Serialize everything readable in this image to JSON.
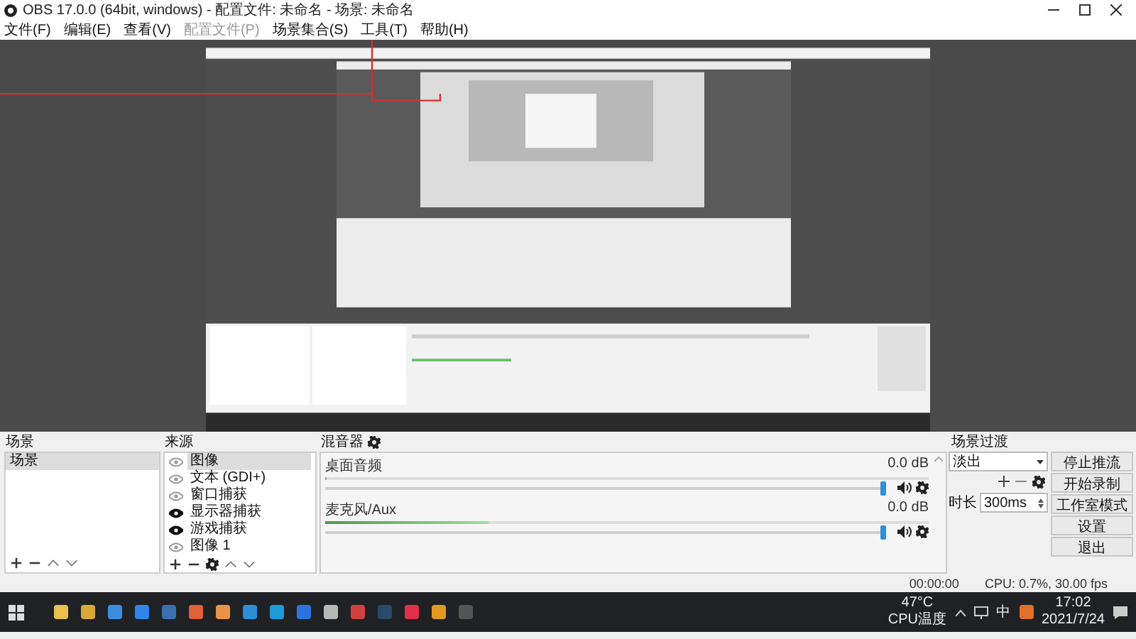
{
  "window": {
    "title": "OBS 17.0.0 (64bit, windows) - 配置文件: 未命名 - 场景: 未命名"
  },
  "menu": [
    {
      "label": "文件(F)",
      "disabled": false
    },
    {
      "label": "编辑(E)",
      "disabled": false
    },
    {
      "label": "查看(V)",
      "disabled": false
    },
    {
      "label": "配置文件(P)",
      "disabled": true
    },
    {
      "label": "场景集合(S)",
      "disabled": false
    },
    {
      "label": "工具(T)",
      "disabled": false
    },
    {
      "label": "帮助(H)",
      "disabled": false
    }
  ],
  "scenes": {
    "title": "场景",
    "items": [
      {
        "label": "场景",
        "selected": true
      }
    ]
  },
  "sources": {
    "title": "来源",
    "items": [
      {
        "label": "图像",
        "visible": false,
        "selected": true
      },
      {
        "label": "文本 (GDI+)",
        "visible": false,
        "selected": false
      },
      {
        "label": "窗口捕获",
        "visible": false,
        "selected": false
      },
      {
        "label": "显示器捕获",
        "visible": true,
        "selected": false
      },
      {
        "label": "游戏捕获",
        "visible": true,
        "selected": false
      },
      {
        "label": "图像 1",
        "visible": false,
        "selected": false
      }
    ]
  },
  "mixer": {
    "title": "混音器",
    "channels": [
      {
        "name": "桌面音频",
        "reading": "0.0 dB",
        "meter": {
          "level": 0
        },
        "volume": {
          "level": 1
        }
      },
      {
        "name": "麦克风/Aux",
        "reading": "0.0 dB",
        "meter": {
          "level": 0.27
        },
        "volume": {
          "level": 1
        }
      }
    ]
  },
  "transitions": {
    "title": "场景过渡",
    "type": "淡出",
    "duration_label": "时长",
    "duration": "300ms"
  },
  "controls": [
    "停止推流",
    "开始录制",
    "工作室模式",
    "设置",
    "退出"
  ],
  "status_bar": {
    "time": "00:00:00",
    "cpu": "CPU: 0.7%, 30.00 fps"
  },
  "taskbar": {
    "temperature": "47°C",
    "temperature_label": "CPU温度",
    "ime": "中",
    "time": "17:02",
    "date": "2021/7/24"
  }
}
